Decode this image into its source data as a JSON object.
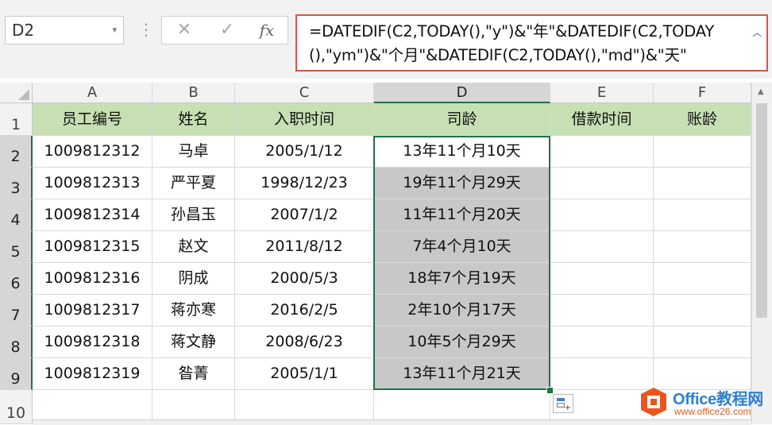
{
  "name_box": "D2",
  "formula_bar": {
    "fx_label": "fx",
    "formula": "=DATEDIF(C2,TODAY(),\"y\")&\"年\"&DATEDIF(C2,TODAY(),\"ym\")&\"个月\"&DATEDIF(C2,TODAY(),\"md\")&\"天\""
  },
  "columns": [
    "A",
    "B",
    "C",
    "D",
    "E",
    "F"
  ],
  "rows": [
    "1",
    "2",
    "3",
    "4",
    "5",
    "6",
    "7",
    "8",
    "9",
    "10"
  ],
  "table": {
    "headers": [
      "员工编号",
      "姓名",
      "入职时间",
      "司龄",
      "借款时间",
      "账龄"
    ],
    "data": [
      [
        "1009812312",
        "马卓",
        "2005/1/12",
        "13年11个月10天",
        "",
        ""
      ],
      [
        "1009812313",
        "严平夏",
        "1998/12/23",
        "19年11个月29天",
        "",
        ""
      ],
      [
        "1009812314",
        "孙昌玉",
        "2007/1/2",
        "11年11个月20天",
        "",
        ""
      ],
      [
        "1009812315",
        "赵文",
        "2011/8/12",
        "7年4个月10天",
        "",
        ""
      ],
      [
        "1009812316",
        "阴成",
        "2000/5/3",
        "18年7个月19天",
        "",
        ""
      ],
      [
        "1009812317",
        "蒋亦寒",
        "2016/2/5",
        "2年10个月17天",
        "",
        ""
      ],
      [
        "1009812318",
        "蒋文静",
        "2008/6/23",
        "10年5个月29天",
        "",
        ""
      ],
      [
        "1009812319",
        "昝菁",
        "2005/1/1",
        "13年11个月21天",
        "",
        ""
      ]
    ]
  },
  "selection": {
    "active_cell": "D2",
    "range": "D2:D9"
  },
  "colors": {
    "header_fill": "#c6e0b4",
    "selection": "#217346",
    "formula_outline": "#d9534f"
  },
  "watermark": {
    "title": "Office教程网",
    "url": "www.office26.com"
  }
}
